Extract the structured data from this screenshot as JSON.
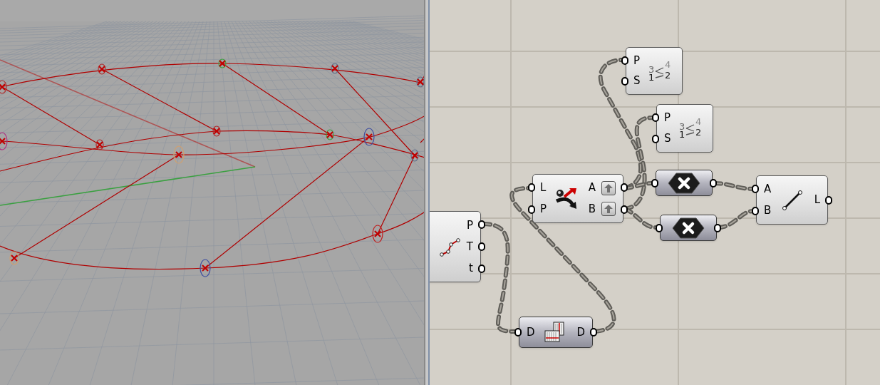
{
  "canvas": {
    "components": [
      {
        "kind": "sort",
        "inputs": [
          "P",
          "S"
        ],
        "icon_text": [
          "3",
          "4",
          "1",
          "2"
        ]
      },
      {
        "kind": "sort",
        "inputs": [
          "P",
          "S"
        ],
        "icon_text": [
          "3",
          "4",
          "1",
          "2"
        ]
      },
      {
        "kind": "evaluate",
        "inputs": [
          "L",
          "P"
        ],
        "outputs": [
          {
            "label": "A",
            "flagged": true
          },
          {
            "label": "B",
            "flagged": true
          }
        ]
      },
      {
        "kind": "negate"
      },
      {
        "kind": "negate"
      },
      {
        "kind": "line",
        "inputs": [
          "A",
          "B"
        ],
        "outputs": [
          {
            "label": "L"
          }
        ]
      },
      {
        "kind": "polyline",
        "outputs": [
          {
            "label": "P"
          },
          {
            "label": "T"
          },
          {
            "label": "t"
          }
        ]
      },
      {
        "kind": "data",
        "inputs": [
          "D"
        ],
        "outputs": [
          {
            "label": "D"
          }
        ]
      }
    ]
  }
}
